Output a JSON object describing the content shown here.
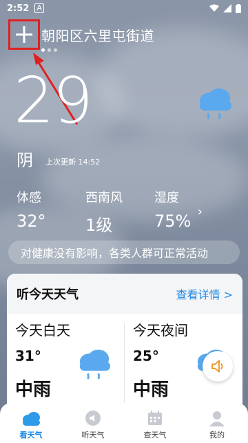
{
  "status_bar": {
    "time": "2:52",
    "indicator": "A"
  },
  "header": {
    "location": "朝阳区六里屯街道"
  },
  "current": {
    "temperature": "29",
    "condition": "阴",
    "updated": "上次更新 14:52"
  },
  "metrics": [
    {
      "label": "体感",
      "value": "32°"
    },
    {
      "label": "西南风",
      "value": "1级"
    },
    {
      "label": "湿度",
      "value": "75%"
    }
  ],
  "advice": "对健康没有影响，各类人群可正常活动",
  "listen_card": {
    "title": "听今天天气",
    "more": "查看详情 >",
    "day": {
      "period": "今天白天",
      "temp": "31°",
      "condition": "中雨"
    },
    "night": {
      "period": "今天夜间",
      "temp": "25°",
      "condition": "中雨"
    }
  },
  "tabs": [
    {
      "label": "看天气",
      "icon": "cloud-icon"
    },
    {
      "label": "听天气",
      "icon": "speaker-icon"
    },
    {
      "label": "查天气",
      "icon": "calendar-icon"
    },
    {
      "label": "我的",
      "icon": "user-icon"
    }
  ],
  "colors": {
    "accent": "#1e88e5",
    "annotation": "#e02020"
  }
}
